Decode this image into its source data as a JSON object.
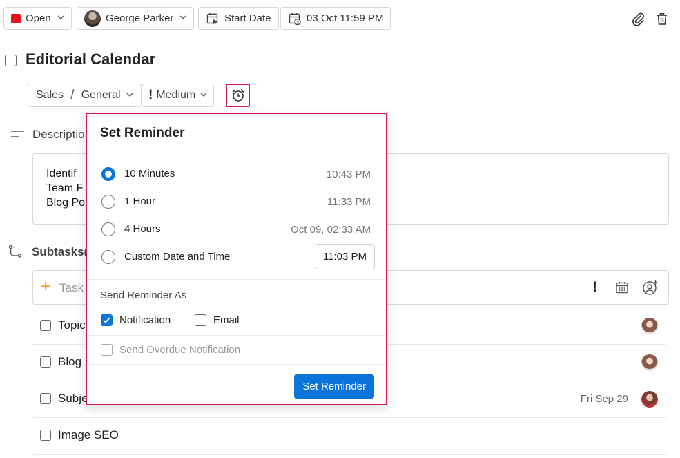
{
  "toolbar": {
    "status": "Open",
    "assignee": "George Parker",
    "start_date": "Start Date",
    "due_date": "03 Oct 11:59 PM"
  },
  "task": {
    "title": "Editorial Calendar",
    "project": "Sales",
    "separator": "/",
    "section": "General",
    "priority_mark": "!",
    "priority": "Medium"
  },
  "description": {
    "label": "Descriptio",
    "lines": [
      "Identif",
      "Team F",
      "Blog Po"
    ]
  },
  "subtasks": {
    "label": "Subtasks(",
    "add_placeholder": "Task",
    "add_plus": "+",
    "priority_mark": "!",
    "items": [
      {
        "label": "Topic",
        "date": ""
      },
      {
        "label": "Blog",
        "date": ""
      },
      {
        "label": "Subje",
        "date": "Fri Sep 29"
      },
      {
        "label": "Image SEO",
        "date": ""
      }
    ]
  },
  "reminder": {
    "title": "Set Reminder",
    "options": [
      {
        "label": "10 Minutes",
        "time": "10:43 PM",
        "selected": true
      },
      {
        "label": "1 Hour",
        "time": "11:33 PM",
        "selected": false
      },
      {
        "label": "4 Hours",
        "time": "Oct 09, 02:33 AM",
        "selected": false
      },
      {
        "label": "Custom Date and Time",
        "time": "11:03 PM",
        "selected": false
      }
    ],
    "send_as_label": "Send Reminder As",
    "notification_label": "Notification",
    "email_label": "Email",
    "overdue_label": "Send Overdue Notification",
    "button_label": "Set Reminder"
  },
  "colors": {
    "accent": "#0a74da",
    "highlight": "#d81b60",
    "status": "#e8101a"
  }
}
